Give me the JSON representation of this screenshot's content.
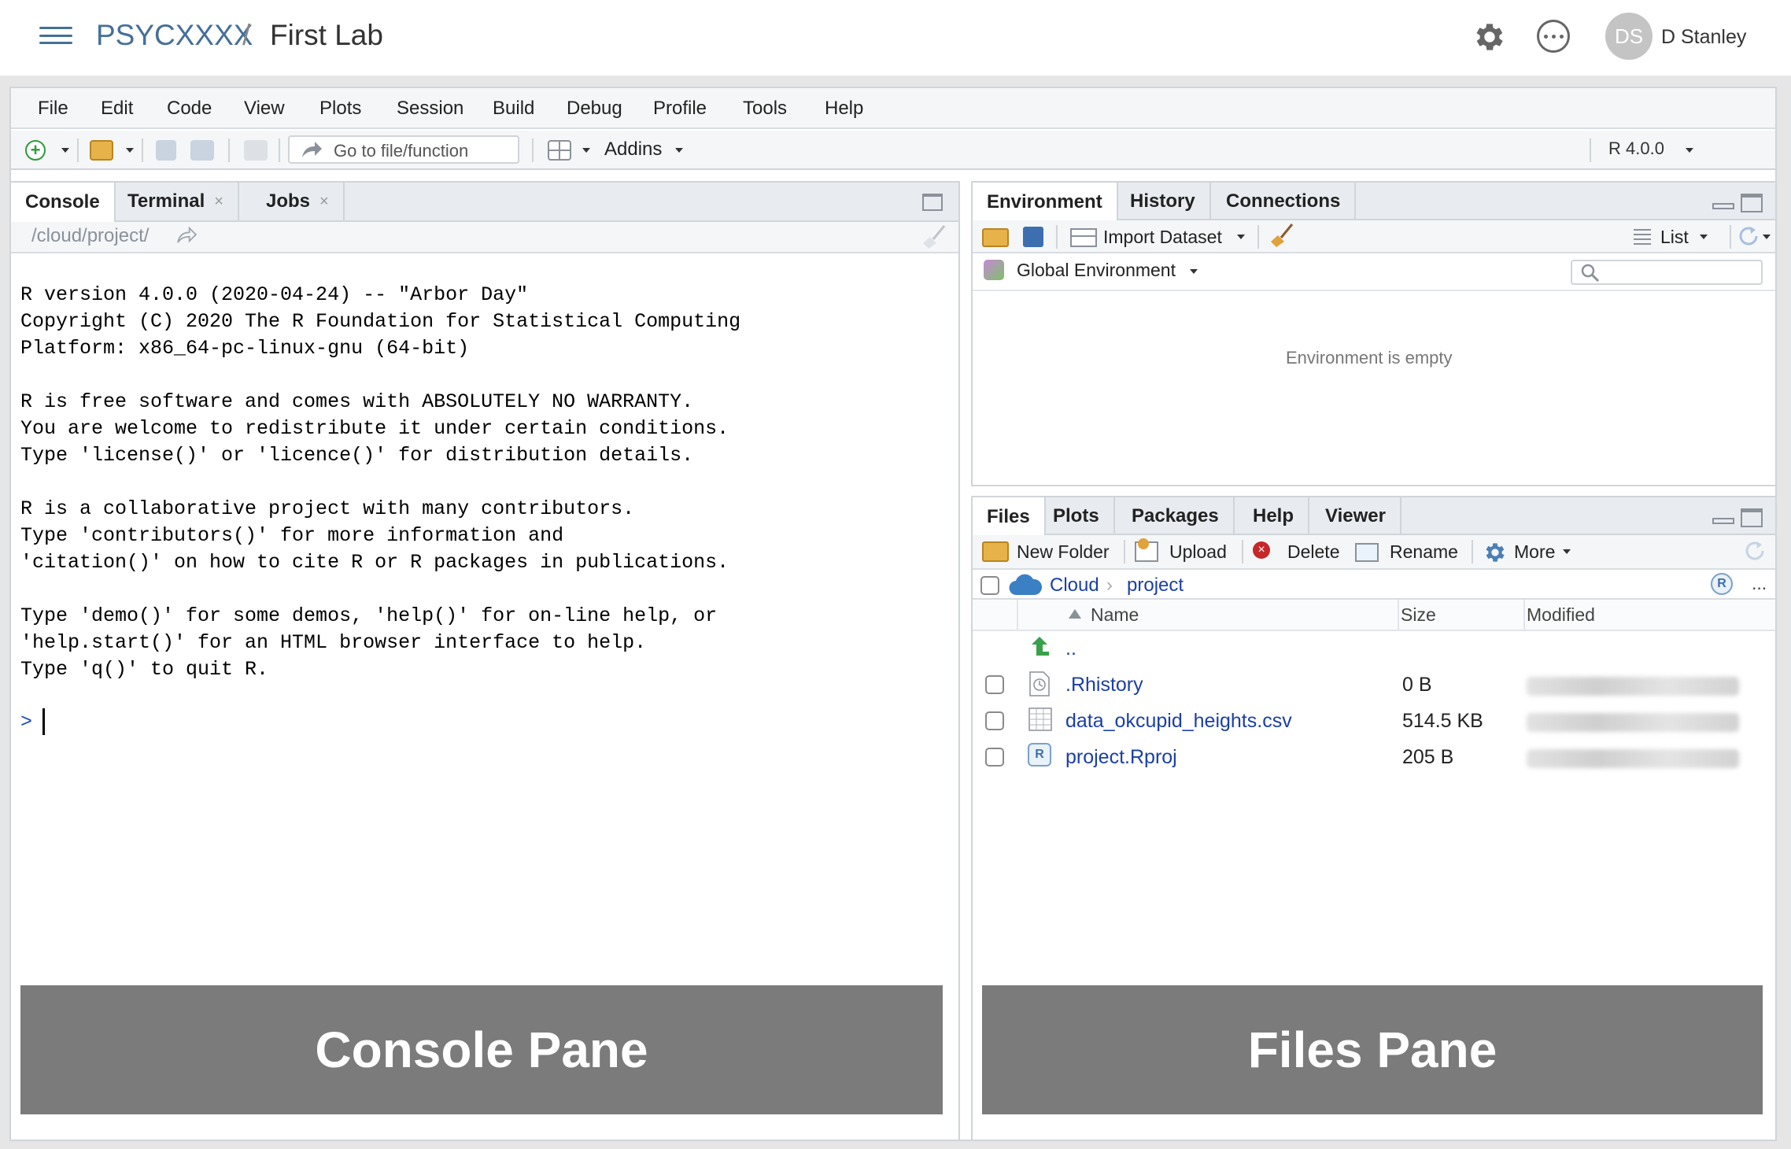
{
  "topbar": {
    "workspace": "PSYCXXXX",
    "separator": "/",
    "project": "First Lab",
    "user_initials": "DS",
    "user_name": "D Stanley"
  },
  "menu": [
    "File",
    "Edit",
    "Code",
    "View",
    "Plots",
    "Session",
    "Build",
    "Debug",
    "Profile",
    "Tools",
    "Help"
  ],
  "toolbar": {
    "goto_placeholder": "Go to file/function",
    "addins_label": "Addins",
    "r_version": "R 4.0.0"
  },
  "console": {
    "tabs": [
      "Console",
      "Terminal",
      "Jobs"
    ],
    "path": "/cloud/project/",
    "output": "R version 4.0.0 (2020-04-24) -- \"Arbor Day\"\nCopyright (C) 2020 The R Foundation for Statistical Computing\nPlatform: x86_64-pc-linux-gnu (64-bit)\n\nR is free software and comes with ABSOLUTELY NO WARRANTY.\nYou are welcome to redistribute it under certain conditions.\nType 'license()' or 'licence()' for distribution details.\n\nR is a collaborative project with many contributors.\nType 'contributors()' for more information and\n'citation()' on how to cite R or R packages in publications.\n\nType 'demo()' for some demos, 'help()' for on-line help, or\n'help.start()' for an HTML browser interface to help.\nType 'q()' to quit R.",
    "prompt": ">"
  },
  "environment": {
    "tabs": [
      "Environment",
      "History",
      "Connections"
    ],
    "import_label": "Import Dataset",
    "view_mode": "List",
    "scope": "Global Environment",
    "empty_message": "Environment is empty"
  },
  "files": {
    "tabs": [
      "Files",
      "Plots",
      "Packages",
      "Help",
      "Viewer"
    ],
    "actions": {
      "new_folder": "New Folder",
      "upload": "Upload",
      "delete": "Delete",
      "rename": "Rename",
      "more": "More"
    },
    "breadcrumb": [
      "Cloud",
      "project"
    ],
    "ellipsis": "...",
    "columns": [
      "Name",
      "Size",
      "Modified"
    ],
    "parent": "..",
    "rows": [
      {
        "name": ".Rhistory",
        "size": "0 B"
      },
      {
        "name": "data_okcupid_heights.csv",
        "size": "514.5 KB"
      },
      {
        "name": "project.Rproj",
        "size": "205 B"
      }
    ]
  },
  "overlays": {
    "console_label": "Console Pane",
    "files_label": "Files Pane"
  },
  "colors": {
    "link": "#447099",
    "file_link": "#1b3fa8",
    "overlay": "#7b7b7b"
  }
}
